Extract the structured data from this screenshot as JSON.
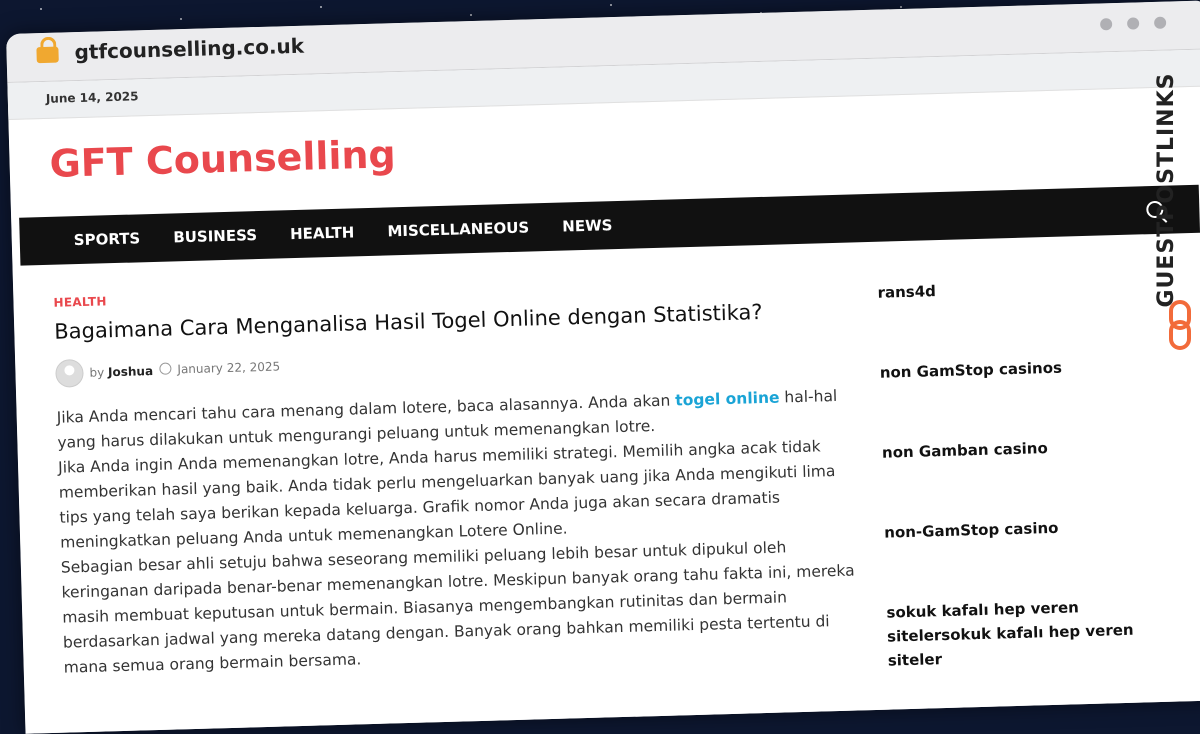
{
  "browser": {
    "url": "gtfcounselling.co.uk"
  },
  "topbar": {
    "date": "June 14, 2025"
  },
  "site": {
    "brand": "GFT Counselling"
  },
  "nav": {
    "items": [
      "SPORTS",
      "BUSINESS",
      "HEALTH",
      "MISCELLANEOUS",
      "NEWS"
    ]
  },
  "article": {
    "category": "HEALTH",
    "title": "Bagaimana Cara Menganalisa Hasil Togel Online dengan Statistika?",
    "by": "by",
    "author": "Joshua",
    "date": "January 22, 2025",
    "p1_a": "Jika Anda mencari tahu cara menang dalam lotere, baca alasannya. Anda akan ",
    "p1_link": "togel online",
    "p1_b": " hal-hal yang harus dilakukan untuk mengurangi peluang untuk memenangkan lotre.",
    "p2": "Jika Anda ingin Anda memenangkan lotre, Anda harus memiliki strategi. Memilih angka acak tidak memberikan hasil yang baik. Anda tidak perlu mengeluarkan banyak uang jika Anda mengikuti lima tips yang telah saya berikan kepada keluarga. Grafik nomor Anda juga akan secara dramatis meningkatkan peluang Anda untuk memenangkan Lotere Online.",
    "p3": "Sebagian besar ahli setuju bahwa seseorang memiliki peluang lebih besar untuk dipukul oleh keringanan daripada benar-benar memenangkan lotre. Meskipun banyak orang tahu fakta ini, mereka masih membuat keputusan untuk bermain. Biasanya mengembangkan rutinitas dan bermain berdasarkan jadwal yang mereka datang dengan. Banyak orang bahkan memiliki pesta tertentu di mana semua orang bermain bersama."
  },
  "sidebar": {
    "links": [
      "rans4d",
      "non GamStop casinos",
      "non Gamban casino",
      "non-GamStop casino",
      "sokuk kafalı hep veren sitelersokuk kafalı hep veren siteler"
    ]
  },
  "watermark": {
    "text": "GUESTPOSTLINKS"
  },
  "colors": {
    "brand": "#e9484d",
    "link": "#1aa4d6",
    "nav_bg": "#111111"
  }
}
